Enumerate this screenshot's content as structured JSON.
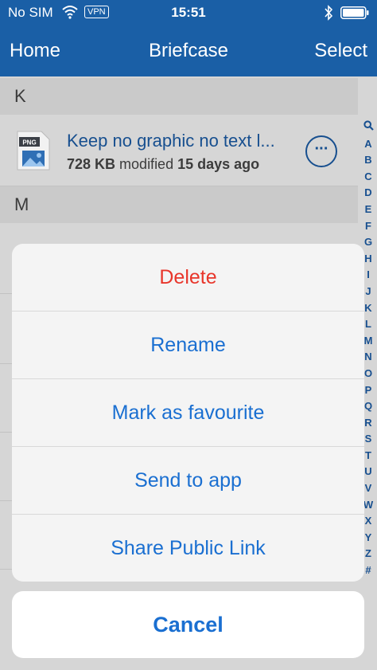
{
  "status_bar": {
    "carrier": "No SIM",
    "vpn": "VPN",
    "time": "15:51"
  },
  "nav": {
    "left": "Home",
    "title": "Briefcase",
    "right": "Select"
  },
  "sections": [
    {
      "letter": "K"
    },
    {
      "letter": "M"
    }
  ],
  "file": {
    "icon_label": "PNG",
    "name": "Keep no graphic no text l...",
    "size": "728 KB",
    "modified_label": "modified",
    "modified": "15 days ago",
    "more": "···"
  },
  "index": [
    "A",
    "B",
    "C",
    "D",
    "E",
    "F",
    "G",
    "H",
    "I",
    "J",
    "K",
    "L",
    "M",
    "N",
    "O",
    "P",
    "Q",
    "R",
    "S",
    "T",
    "U",
    "V",
    "W",
    "X",
    "Y",
    "Z",
    "#"
  ],
  "sheet": {
    "items": [
      {
        "label": "Delete"
      },
      {
        "label": "Rename"
      },
      {
        "label": "Mark as favourite"
      },
      {
        "label": "Send to app"
      },
      {
        "label": "Share Public Link"
      }
    ],
    "cancel": "Cancel"
  },
  "colors": {
    "header_blue": "#1a5fa6",
    "link_blue": "#1a6fd1",
    "destructive_red": "#e8362b"
  }
}
